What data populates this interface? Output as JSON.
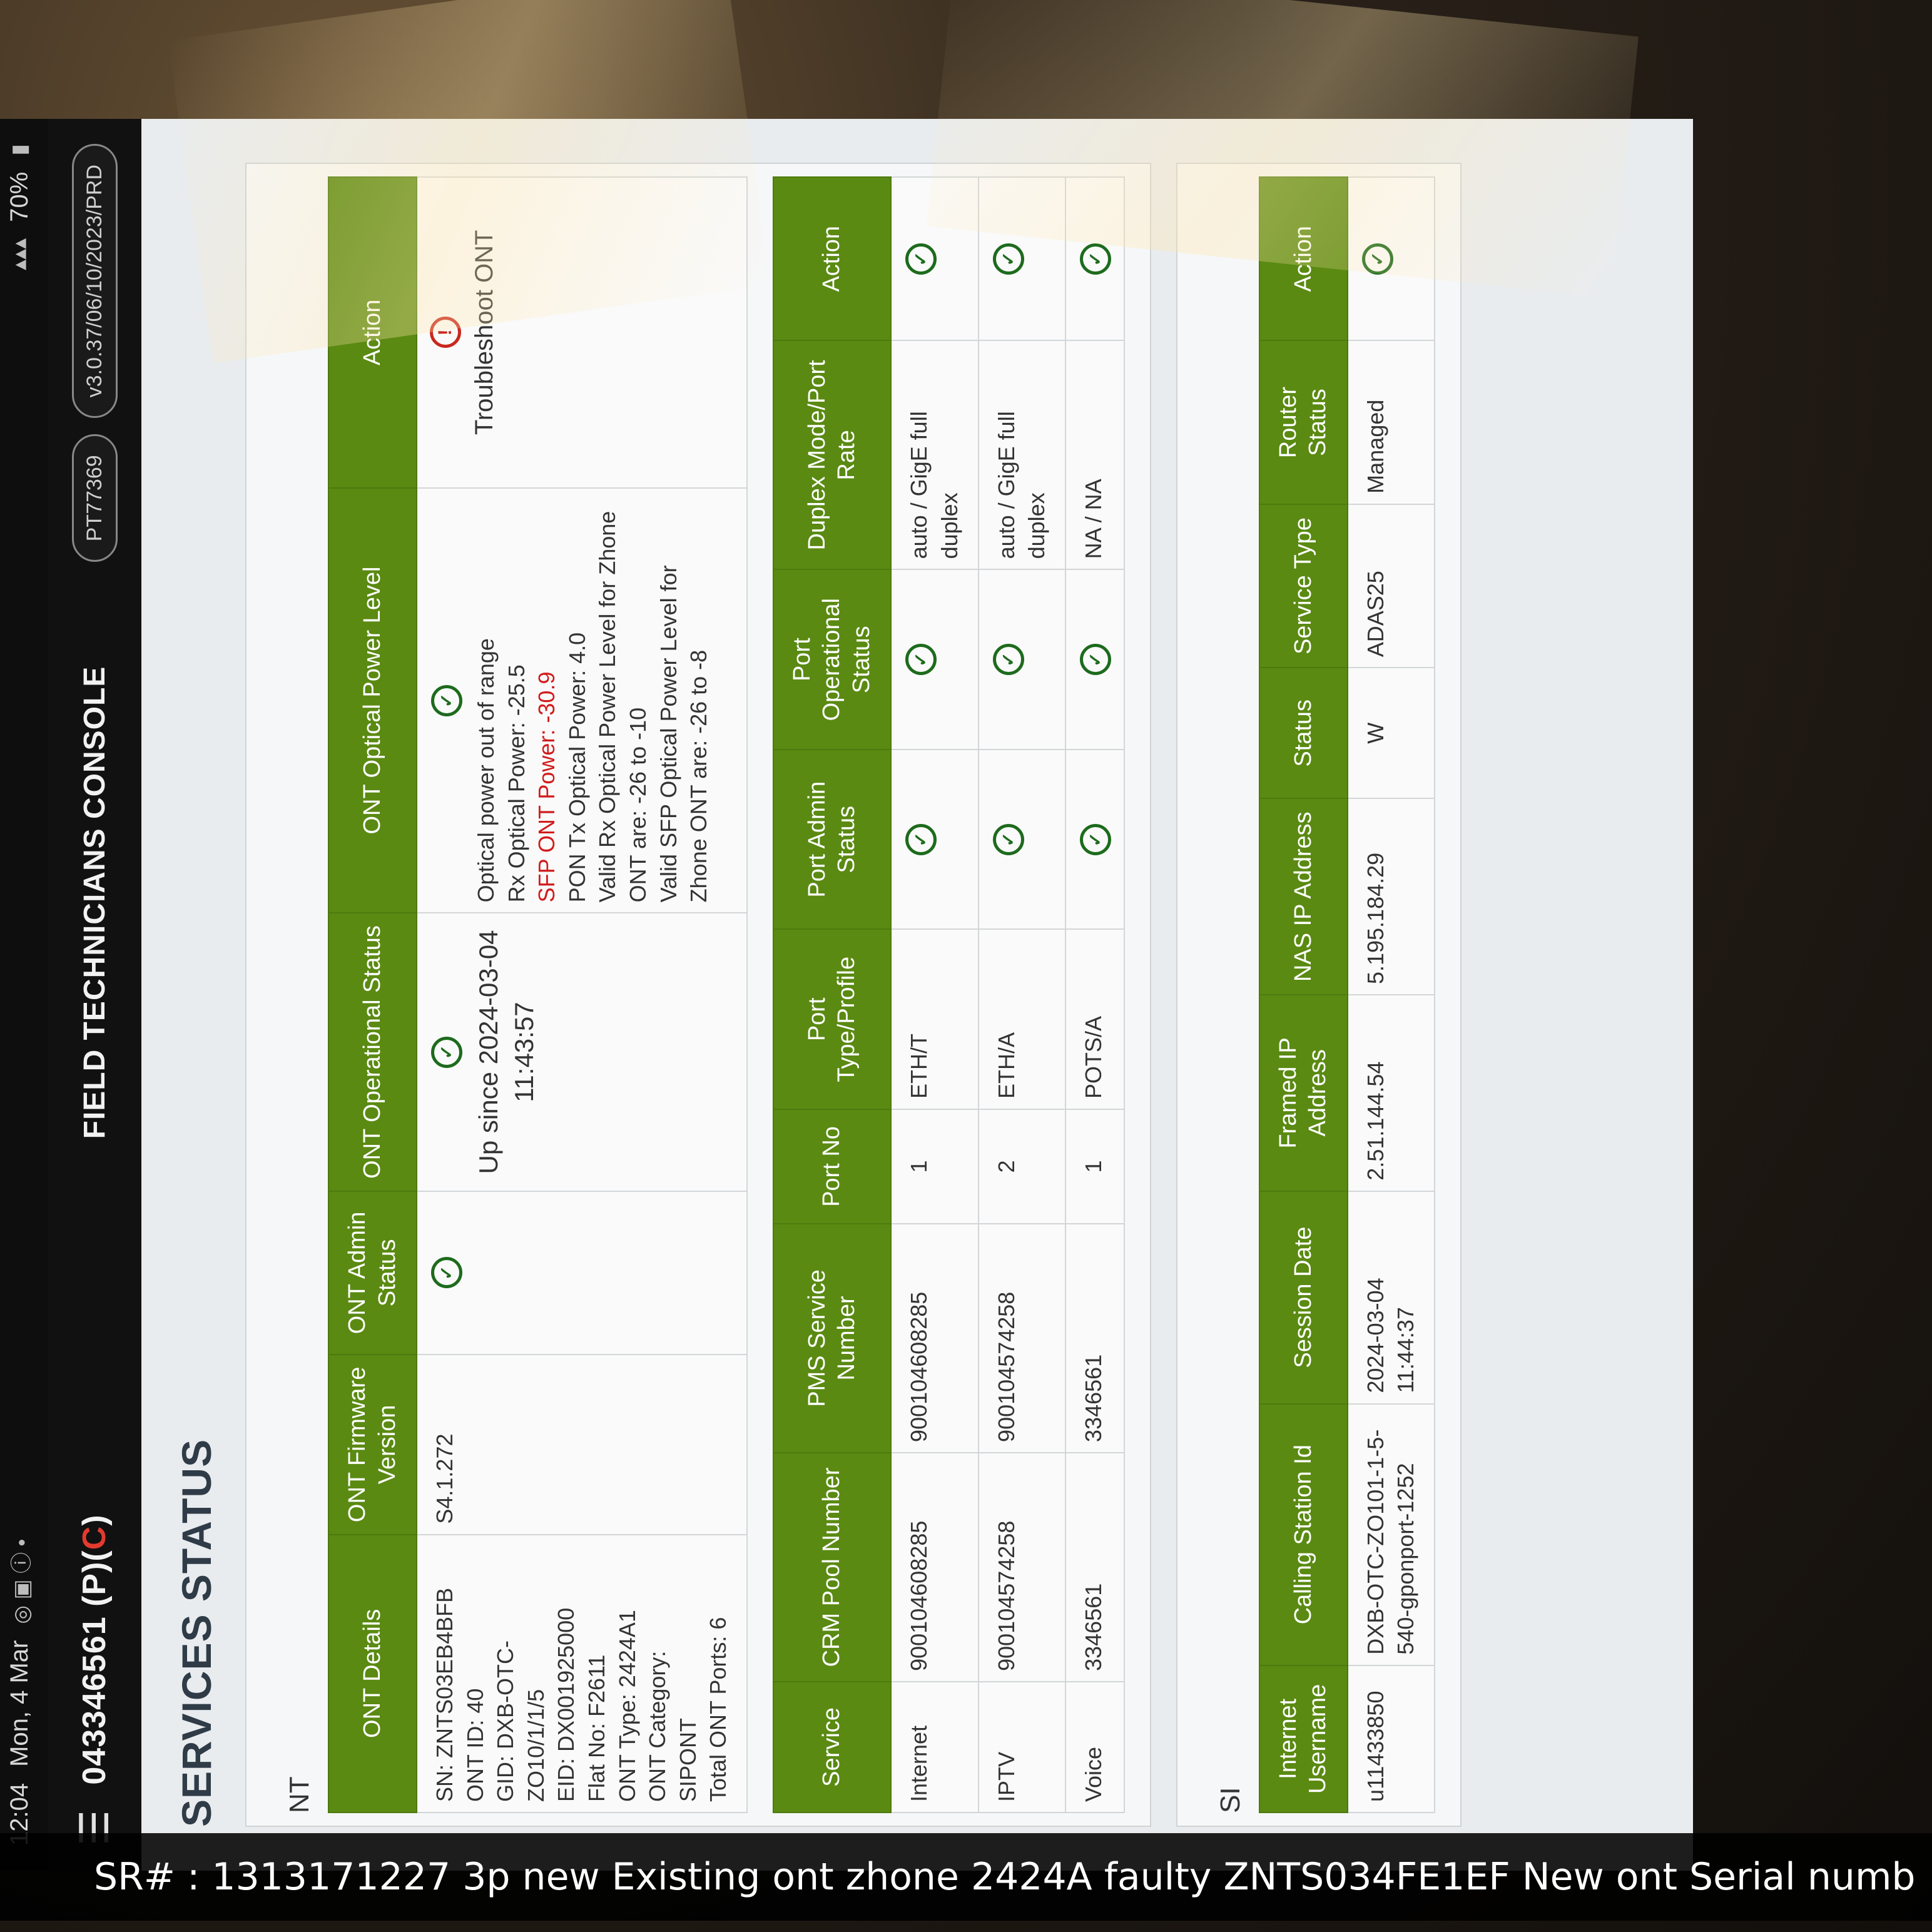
{
  "status_bar": {
    "time": "12:04",
    "date": "Mon, 4 Mar",
    "battery": "70%"
  },
  "app_bar": {
    "account_prefix": "043346561 (P)(",
    "account_flag": "C",
    "account_suffix": ")",
    "console_title": "FIELD TECHNICIANS CONSOLE",
    "chip_user": "PT77369",
    "chip_version": "v3.0.37/06/10/2023/PRD"
  },
  "page": {
    "title": "SERVICES STATUS"
  },
  "nt": {
    "label": "NT",
    "headers": [
      "ONT Details",
      "ONT Firmware Version",
      "ONT Admin Status",
      "ONT Operational Status",
      "ONT Optical Power Level",
      "Action"
    ],
    "details": [
      "SN: ZNTS03EB4BFB",
      "ONT ID: 40",
      "GID: DXB-OTC-",
      "ZO10/1/1/5",
      "EID: DX001925000",
      "Flat No: F2611",
      "ONT Type: 2424A1",
      "ONT Category:",
      "SIPONT",
      "Total ONT Ports: 6"
    ],
    "firmware": "S4.1.272",
    "operational_text": "Up since 2024-03-04 11:43:57",
    "optical": {
      "line1": "Optical power out of range",
      "line2": "Rx Optical Power: -25.5",
      "line3_red": "SFP ONT Power: -30.9",
      "line4": "PON Tx Optical Power: 4.0",
      "line5": "Valid Rx Optical Power Level for Zhone ONT are: -26 to -10",
      "line6": "Valid SFP Optical Power Level for Zhone ONT are: -26 to -8"
    },
    "action_label": "Troubleshoot ONT"
  },
  "ports": {
    "headers": [
      "Service",
      "CRM Pool Number",
      "PMS Service Number",
      "Port No",
      "Port Type/Profile",
      "Port Admin Status",
      "Port Operational Status",
      "Duplex Mode/Port Rate",
      "Action"
    ],
    "rows": [
      {
        "service": "Internet",
        "crm": "900104608285",
        "pms": "900104608285",
        "port": "1",
        "type": "ETH/T",
        "duplex": "auto / GigE full duplex"
      },
      {
        "service": "IPTV",
        "crm": "900104574258",
        "pms": "900104574258",
        "port": "2",
        "type": "ETH/A",
        "duplex": "auto / GigE full duplex"
      },
      {
        "service": "Voice",
        "crm": "3346561",
        "pms": "3346561",
        "port": "1",
        "type": "POTS/A",
        "duplex": "NA / NA"
      }
    ]
  },
  "si": {
    "label": "SI",
    "headers": [
      "Internet Username",
      "Calling Station Id",
      "Session Date",
      "Framed IP Address",
      "NAS IP Address",
      "Status",
      "Service Type",
      "Router Status",
      "Action"
    ],
    "row": {
      "username": "u11433850",
      "calling": "DXB-OTC-ZO101-1-5-540-gponport-1252",
      "date": "2024-03-04 11:44:37",
      "framed": "2.51.144.54",
      "nas": "5.195.184.29",
      "status": "W",
      "service_type": "ADAS25",
      "router": "Managed"
    }
  },
  "caption": "SR# : 1313171227 3p new Existing ont zhone 2424A faulty ZNTS034FE1EF New ont Serial numb",
  "icons": {
    "ok": "check-circle-icon",
    "warn": "alert-circle-icon",
    "menu": "hamburger-menu-icon"
  },
  "colors": {
    "header_green": "#5a8a12",
    "ok_green": "#1d6b1d",
    "alert_red": "#d11b1b"
  }
}
